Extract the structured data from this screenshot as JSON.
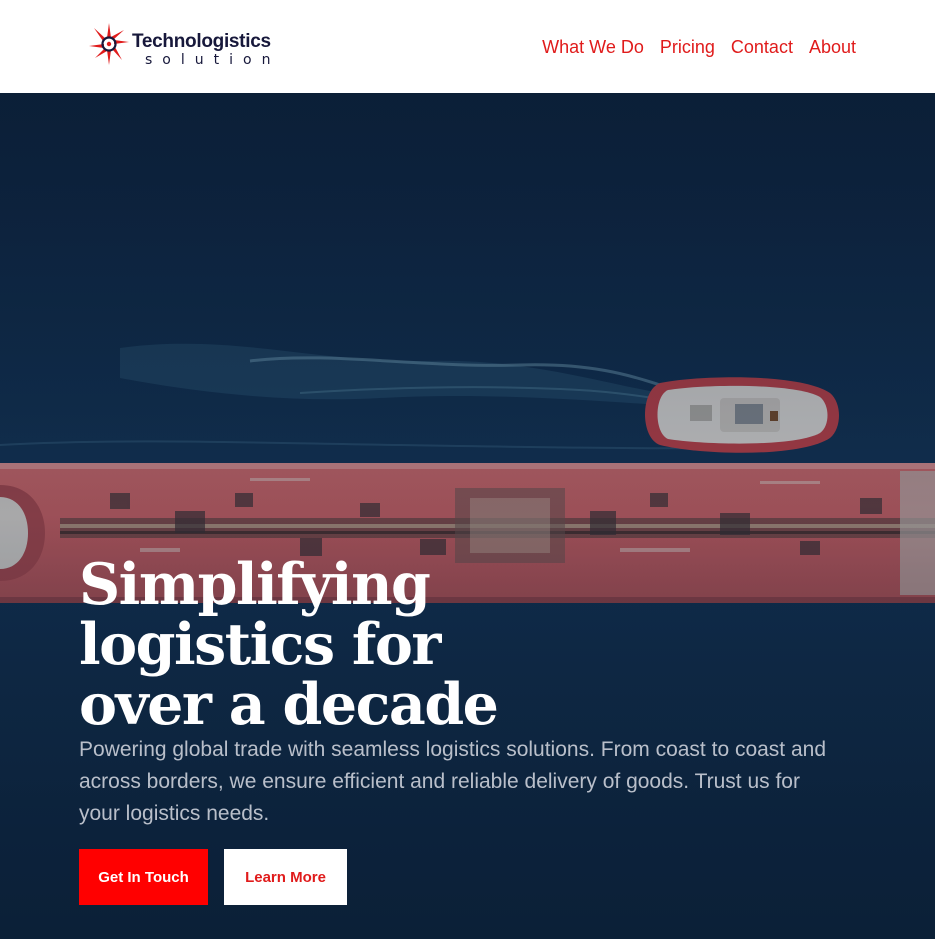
{
  "brand": {
    "name": "Technologistics",
    "tagline": "solution"
  },
  "nav": {
    "items": [
      {
        "label": "What We Do"
      },
      {
        "label": "Pricing"
      },
      {
        "label": "Contact"
      },
      {
        "label": "About"
      }
    ]
  },
  "hero": {
    "title": "Simplifying\nlogistics for\nover a decade",
    "description": "Powering global trade with seamless logistics solutions. From coast to coast and across borders, we ensure efficient and reliable delivery of goods. Trust us for your logistics needs.",
    "primary_button": "Get In Touch",
    "secondary_button": "Learn More",
    "background_image": "aerial-cargo-ship-with-tugboat"
  },
  "colors": {
    "accent": "#ff0000",
    "nav_link": "#e01b1b",
    "logo_text": "#17183b",
    "hero_overlay": "#0f2a46",
    "hero_text": "#ffffff",
    "hero_subtext": "#b9bfca"
  },
  "icons": {
    "logo_mark": "logo-star-mark-icon"
  }
}
